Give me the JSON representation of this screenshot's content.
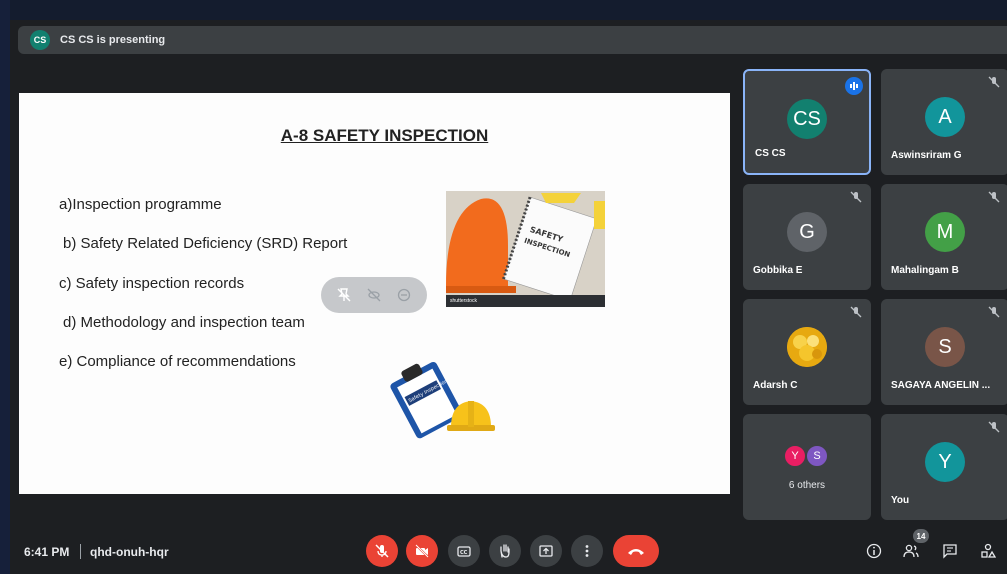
{
  "banner": {
    "avatar_initials": "CS",
    "text": "CS CS is presenting"
  },
  "slide": {
    "title": "A-8 SAFETY INSPECTION",
    "items": [
      "a)Inspection programme",
      "b) Safety Related Deficiency (SRD) Report",
      "c) Safety inspection records",
      "d) Methodology and inspection team",
      "e) Compliance of recommendations"
    ],
    "photo_text": "SAFETY INSPECTION",
    "photo_caption": "shutterstock",
    "clipboard_text": "Safety Inspection"
  },
  "participants": [
    {
      "initials": "CS",
      "name": "CS CS",
      "color": "#12806f",
      "state": "speaking"
    },
    {
      "initials": "A",
      "name": "Aswinsriram G",
      "color": "#12959b",
      "state": "muted"
    },
    {
      "initials": "G",
      "name": "Gobbika E",
      "color": "#5f6368",
      "state": "muted"
    },
    {
      "initials": "M",
      "name": "Mahalingam B",
      "color": "#43a047",
      "state": "muted"
    },
    {
      "initials": "",
      "name": "Adarsh C",
      "color": "#f2b51c",
      "state": "muted"
    },
    {
      "initials": "S",
      "name": "SAGAYA ANGELIN ...",
      "color": "#795548",
      "state": "muted"
    },
    {
      "initials": "Y",
      "name": "You",
      "color": "#12959b",
      "state": "muted"
    }
  ],
  "others": {
    "label": "6 others",
    "avatars": [
      {
        "initials": "Y",
        "color": "#e91e63"
      },
      {
        "initials": "S",
        "color": "#7e57c2"
      }
    ]
  },
  "bottom_bar": {
    "time": "6:41 PM",
    "meeting_code": "qhd-onuh-hqr",
    "participant_count": "14"
  },
  "colors": {
    "background": "#1d1f22",
    "tile": "#3c4043",
    "danger": "#ea4335",
    "accent": "#8ab4f8"
  }
}
